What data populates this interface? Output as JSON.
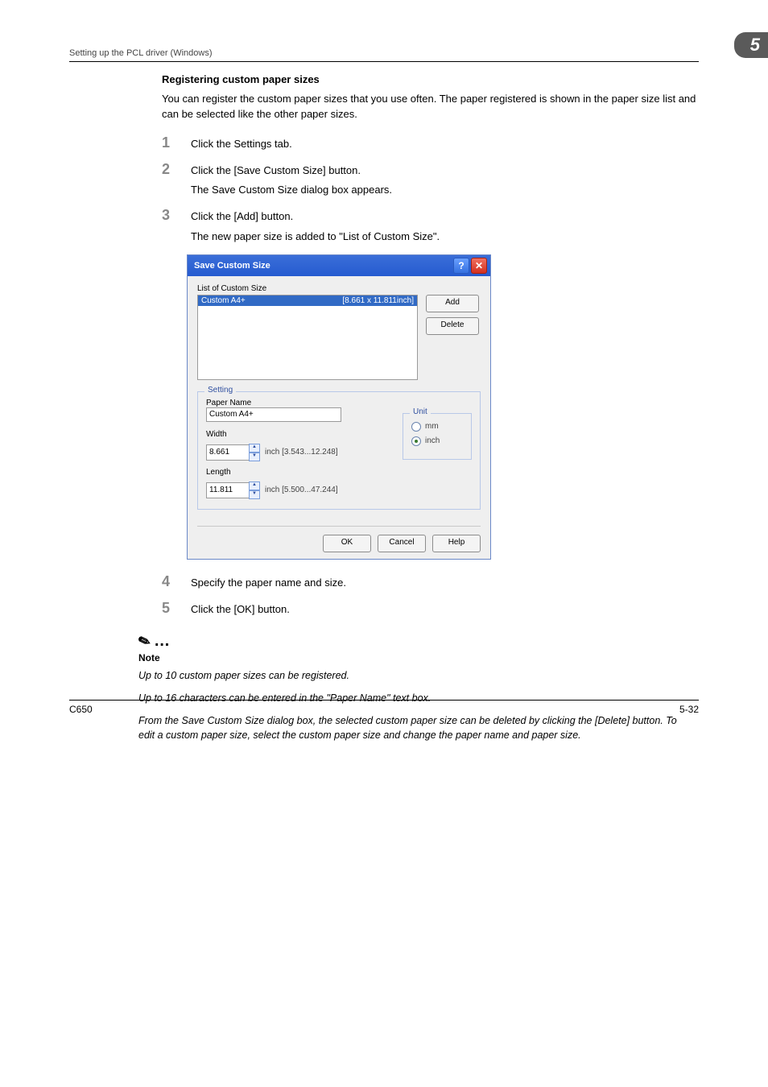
{
  "header": {
    "breadcrumb": "Setting up the PCL driver (Windows)",
    "chapter": "5"
  },
  "section": {
    "title": "Registering custom paper sizes",
    "intro": "You can register the custom paper sizes that you use often. The paper registered is shown in the paper size list and can be selected like the other paper sizes."
  },
  "steps": {
    "s1": {
      "num": "1",
      "text": "Click the Settings tab."
    },
    "s2": {
      "num": "2",
      "text": "Click the [Save Custom Size] button.",
      "sub": "The Save Custom Size dialog box appears."
    },
    "s3": {
      "num": "3",
      "text": "Click the [Add] button.",
      "sub": "The new paper size is added to \"List of Custom Size\"."
    },
    "s4": {
      "num": "4",
      "text": "Specify the paper name and size."
    },
    "s5": {
      "num": "5",
      "text": "Click the [OK] button."
    }
  },
  "dialog": {
    "title": "Save Custom Size",
    "list_label": "List of Custom Size",
    "list_item_name": "Custom A4+",
    "list_item_dim": "[8.661 x 11.811inch]",
    "add_label": "Add",
    "delete_label": "Delete",
    "fieldset": {
      "legend": "Setting",
      "paper_name_label": "Paper Name",
      "paper_name_value": "Custom A4+",
      "width_label": "Width",
      "width_value": "8.661",
      "width_hint": "inch [3.543...12.248]",
      "length_label": "Length",
      "length_value": "11.811",
      "length_hint": "inch [5.500...47.244]",
      "unit_legend": "Unit",
      "unit_mm": "mm",
      "unit_inch": "inch"
    },
    "ok_label": "OK",
    "cancel_label": "Cancel",
    "help_label": "Help"
  },
  "note": {
    "label": "Note",
    "p1": "Up to 10 custom paper sizes can be registered.",
    "p2": "Up to 16 characters can be entered in the \"Paper Name\" text box.",
    "p3": "From the Save Custom Size dialog box, the selected custom paper size can be deleted by clicking the [Delete] button. To edit a custom paper size, select the custom paper size and change the paper name and paper size."
  },
  "footer": {
    "left": "C650",
    "right": "5-32"
  }
}
